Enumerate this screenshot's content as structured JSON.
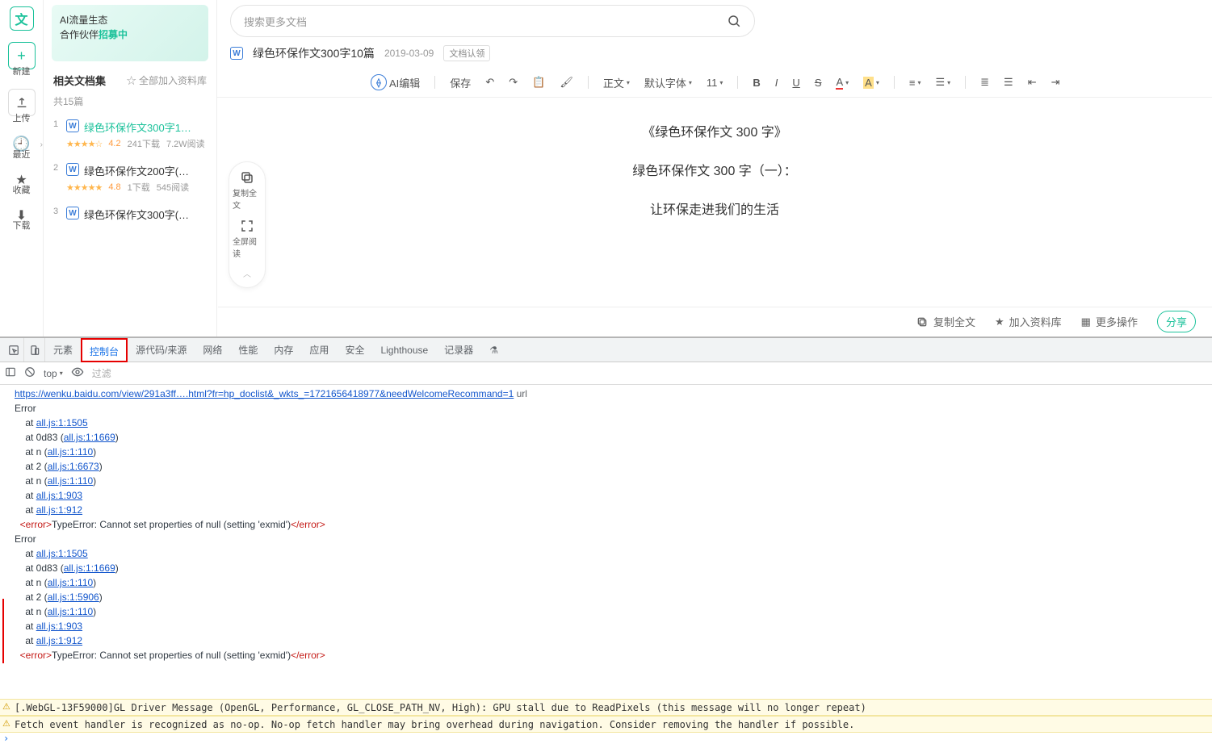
{
  "search": {
    "placeholder": "搜索更多文档"
  },
  "leftnav": {
    "logo": "文",
    "new": "新建",
    "upload": "上传",
    "recent": "最近",
    "fav": "收藏",
    "download": "下载"
  },
  "banner": {
    "line1": "AI流量生态",
    "line2": "合作伙伴",
    "highlight": "招募中"
  },
  "related": {
    "title": "相关文档集",
    "addall": "☆ 全部加入资料库",
    "count": "共15篇",
    "items": [
      {
        "idx": "1",
        "name": "绿色环保作文300字1…",
        "rating": "4.2",
        "dl": "241下载",
        "read": "7.2W阅读",
        "stars": "★★★★☆",
        "active": true
      },
      {
        "idx": "2",
        "name": "绿色环保作文200字(…",
        "rating": "4.8",
        "dl": "1下载",
        "read": "545阅读",
        "stars": "★★★★★",
        "active": false
      },
      {
        "idx": "3",
        "name": "绿色环保作文300字(…",
        "rating": "",
        "dl": "",
        "read": "",
        "stars": "",
        "active": false
      }
    ]
  },
  "doc": {
    "title": "绿色环保作文300字10篇",
    "date": "2019-03-09",
    "claim": "文档认领",
    "p1": "《绿色环保作文 300 字》",
    "p2": "绿色环保作文 300 字（一）：",
    "p3": "让环保走进我们的生活"
  },
  "toolbar": {
    "ai": "AI编辑",
    "save": "保存",
    "body": "正文",
    "font": "默认字体",
    "size": "11"
  },
  "float": {
    "copy": "复制全文",
    "full": "全屏阅读"
  },
  "actions": {
    "copy": "复制全文",
    "add": "加入资料库",
    "more": "更多操作",
    "share": "分享"
  },
  "devtools": {
    "tabs": [
      "元素",
      "控制台",
      "源代码/来源",
      "网络",
      "性能",
      "内存",
      "应用",
      "安全",
      "Lighthouse",
      "记录器"
    ],
    "active_idx": 1,
    "ctx": "top",
    "filter": "过滤",
    "url": "https://wenku.baidu.com/view/291a3ff….html?fr=hp_doclist&_wkts_=1721656418977&needWelcomeRecommand=1",
    "url_suffix": " url",
    "err_label": "Error",
    "stack1": [
      "    at all.js:1:1505",
      "    at 0d83 (all.js:1:1669)",
      "    at n (all.js:1:110)",
      "    at 2 (all.js:1:6673)",
      "    at n (all.js:1:110)",
      "    at all.js:1:903",
      "    at all.js:1:912"
    ],
    "type_err": "TypeError: Cannot set properties of null (setting 'exmid')",
    "stack2": [
      "    at all.js:1:1505",
      "    at 0d83 (all.js:1:1669)",
      "    at n (all.js:1:110)",
      "    at 2 (all.js:1:5906)",
      "    at n (all.js:1:110)",
      "    at all.js:1:903",
      "    at all.js:1:912"
    ],
    "warn1": "[.WebGL-13F59000]GL Driver Message (OpenGL, Performance, GL_CLOSE_PATH_NV, High): GPU stall due to ReadPixels (this message will no longer repeat)",
    "warn2": "Fetch event handler is recognized as no-op. No-op fetch handler may bring overhead during navigation. Consider removing the handler if possible."
  }
}
